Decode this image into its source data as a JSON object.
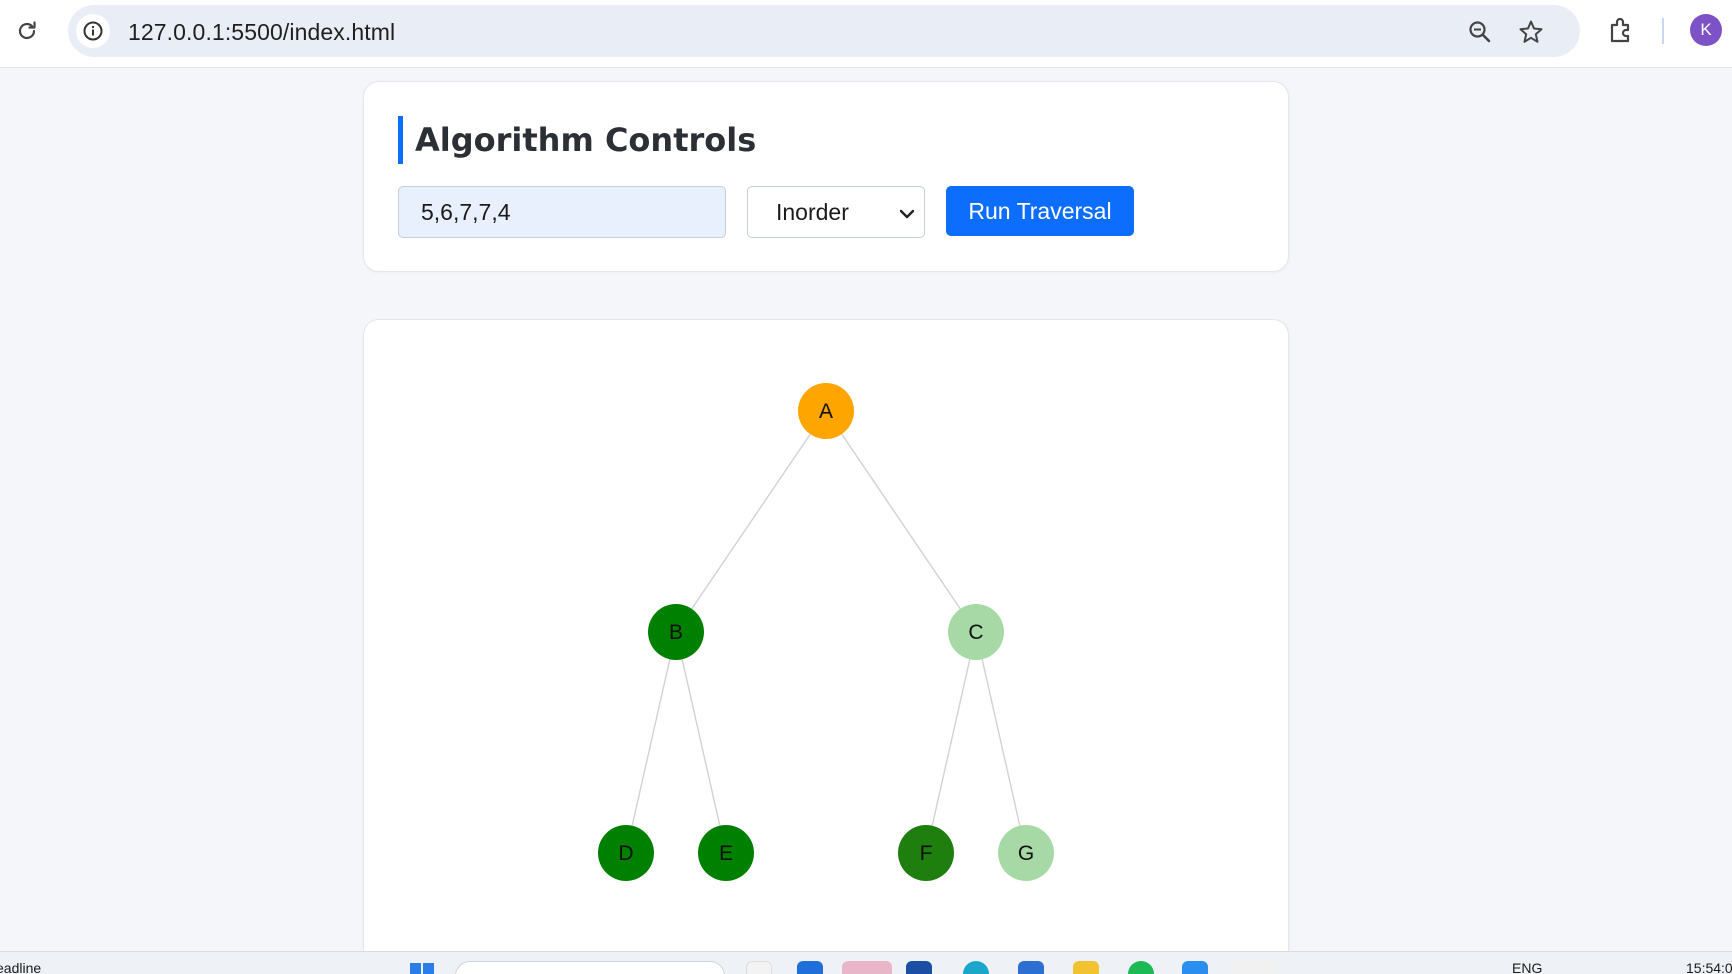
{
  "browser": {
    "url": "127.0.0.1:5500/index.html",
    "profile_initial": "K",
    "icons": [
      "reload-icon",
      "site-info-icon",
      "zoom-icon",
      "bookmark-star-icon",
      "extensions-icon"
    ]
  },
  "controls": {
    "title": "Algorithm Controls",
    "sequence_input": {
      "value": "5,6,7,7,4"
    },
    "traversal_select": {
      "selected": "Inorder"
    },
    "run_button_label": "Run Traversal"
  },
  "tree": {
    "nodes": [
      {
        "id": "A",
        "label": "A",
        "state": "current",
        "color": "#ffa500"
      },
      {
        "id": "B",
        "label": "B",
        "state": "visited",
        "color": "#008000"
      },
      {
        "id": "C",
        "label": "C",
        "state": "pending",
        "color": "#a6d9a6"
      },
      {
        "id": "D",
        "label": "D",
        "state": "visited",
        "color": "#008000"
      },
      {
        "id": "E",
        "label": "E",
        "state": "visited",
        "color": "#008000"
      },
      {
        "id": "F",
        "label": "F",
        "state": "visited",
        "color": "#1e7e0e"
      },
      {
        "id": "G",
        "label": "G",
        "state": "pending",
        "color": "#a6d9a6"
      }
    ],
    "edges": [
      [
        "A",
        "B"
      ],
      [
        "A",
        "C"
      ],
      [
        "B",
        "D"
      ],
      [
        "B",
        "E"
      ],
      [
        "C",
        "F"
      ],
      [
        "C",
        "G"
      ]
    ],
    "edge_color": "#cfd2d6"
  },
  "taskbar": {
    "left_text": "eadline",
    "language": "ENG",
    "clock": "15:54:0"
  }
}
